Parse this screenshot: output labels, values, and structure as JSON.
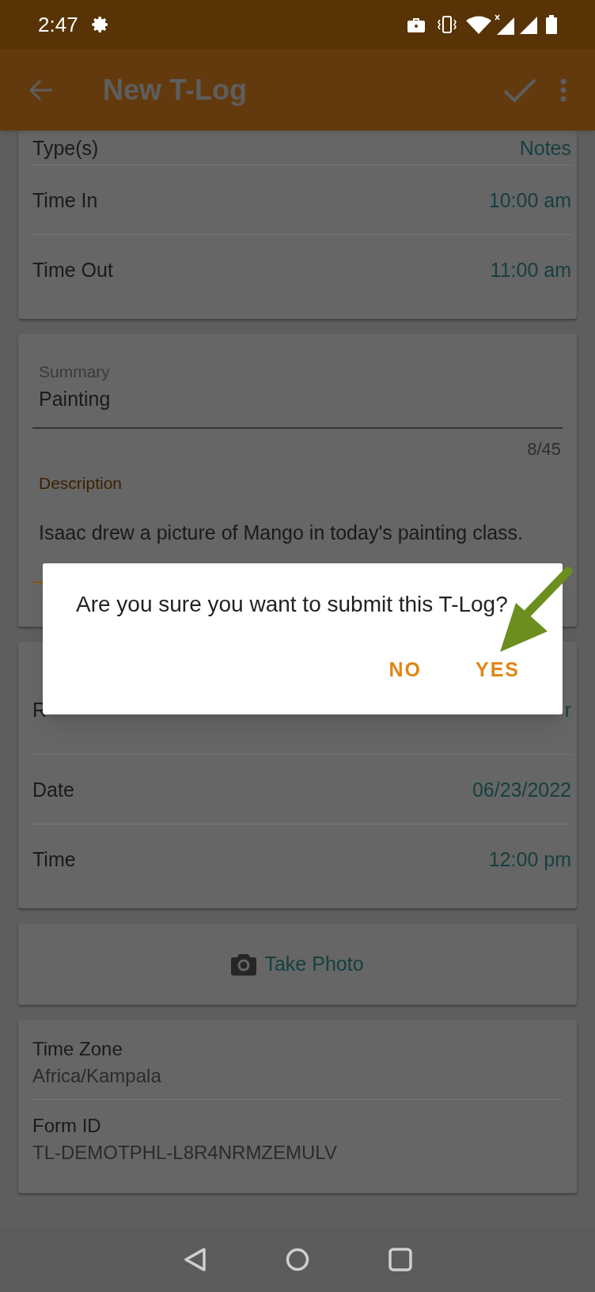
{
  "status_bar": {
    "time": "2:47"
  },
  "app_bar": {
    "title": "New T-Log"
  },
  "sections": [
    {
      "kind": "rows",
      "rows": [
        {
          "label": "Type(s)",
          "value": "Notes"
        },
        {
          "label": "Time In",
          "value": "10:00 am"
        },
        {
          "label": "Time Out",
          "value": "11:00 am"
        }
      ]
    },
    {
      "kind": "text_fields",
      "fields": [
        {
          "label": "Summary",
          "value": "Painting",
          "counter": "8/45",
          "focused": false
        },
        {
          "label": "Description",
          "value": "Isaac drew a picture of Mango in today's painting class.",
          "focused": true
        }
      ]
    },
    {
      "kind": "rows",
      "rows": [
        {
          "label": "R",
          "value": "r"
        },
        {
          "label": "Date",
          "value": "06/23/2022"
        },
        {
          "label": "Time",
          "value": "12:00 pm"
        }
      ]
    },
    {
      "kind": "photo_button",
      "label": "Take Photo"
    },
    {
      "kind": "info",
      "items": [
        {
          "label": "Time Zone",
          "value": "Africa/Kampala"
        },
        {
          "label": "Form ID",
          "value": "TL-DEMOTPHL-L8R4NRMZEMULV"
        }
      ]
    }
  ],
  "dialog": {
    "message": "Are you sure you want to submit this T-Log?",
    "buttons": [
      "NO",
      "YES"
    ]
  }
}
